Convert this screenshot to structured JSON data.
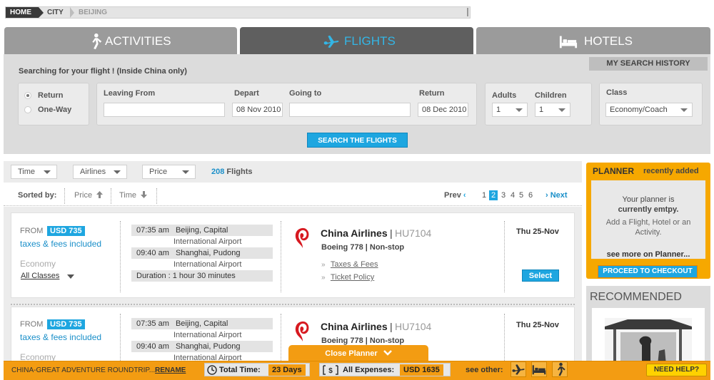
{
  "breadcrumb": [
    "HOME",
    "CITY",
    "BEIJING"
  ],
  "tabs": {
    "activities": "ACTIVITIES",
    "flights": "FLIGHTS",
    "hotels": "HOTELS"
  },
  "search": {
    "title": "Searching for your flight ! (Inside China only)",
    "history": "MY SEARCH HISTORY",
    "trip_types": [
      "Return",
      "One-Way"
    ],
    "leaving_from_label": "Leaving From",
    "depart_label": "Depart",
    "depart_value": "08 Nov 2010",
    "going_to_label": "Going to",
    "return_label": "Return",
    "return_value": "08 Dec 2010",
    "adults_label": "Adults",
    "adults_value": "1",
    "children_label": "Children",
    "children_value": "1",
    "class_label": "Class",
    "class_value": "Economy/Coach",
    "button": "SEARCH THE FLIGHTS"
  },
  "filters": {
    "time": "Time",
    "airlines": "Airlines",
    "price": "Price",
    "count": "208",
    "count_label": "Flights"
  },
  "sort": {
    "label": "Sorted by:",
    "price": "Price",
    "time": "Time"
  },
  "pager": {
    "prev": "Prev",
    "next": "Next",
    "pages": [
      "1",
      "2",
      "3",
      "4",
      "5",
      "6"
    ],
    "current": "2"
  },
  "results": [
    {
      "from": "FROM",
      "price": "USD 735",
      "taxes": "taxes & fees included",
      "cabin": "Economy",
      "classes": "All Classes",
      "dep_time": "07:35 am",
      "dep_city": "Beijing, Capital",
      "dep_airport": "International Airport",
      "arr_time": "09:40 am",
      "arr_city": "Shanghai, Pudong",
      "arr_airport": "International Airport",
      "duration": "Duration : 1 hour 30 minutes",
      "airline": "China Airlines",
      "flight_no": "HU7104",
      "aircraft": "Boeing 778 | Non-stop",
      "taxes_link": "Taxes & Fees",
      "policy_link": "Ticket Policy",
      "date": "Thu 25-Nov",
      "select": "Select"
    },
    {
      "from": "FROM",
      "price": "USD 735",
      "taxes": "taxes & fees included",
      "cabin": "Economy",
      "dep_time": "07:35 am",
      "dep_city": "Beijing, Capital",
      "dep_airport": "International Airport",
      "arr_time": "09:40 am",
      "arr_city": "Shanghai, Pudong",
      "arr_airport": "International Airport",
      "airline": "China Airlines",
      "flight_no": "HU7104",
      "aircraft": "Boeing 778 | Non-stop",
      "date": "Thu 25-Nov"
    }
  ],
  "planner": {
    "title": "PLANNER",
    "recent": "recently added",
    "line1": "Your planner is",
    "line2": "currently emtpy.",
    "line3": "Add a Flight, Hotel or an",
    "line4": "Activity.",
    "more": "see more on Planner...",
    "checkout": "PROCEED TO CHECKOUT"
  },
  "recommended": "RECOMMENDED",
  "bottom": {
    "close": "Close Planner",
    "trip": "CHINA-GREAT ADVENTURE ROUNDTRIP...",
    "rename": "RENAME",
    "total_time_label": "Total Time:",
    "total_time": "23 Days",
    "expenses_label": "All Expenses:",
    "expenses": "USD 1635",
    "see_other": "see other:",
    "help": "NEED HELP?"
  },
  "colors": {
    "accent_blue": "#1ea6e0",
    "accent_orange": "#f39c12",
    "airline_red": "#d71920"
  }
}
